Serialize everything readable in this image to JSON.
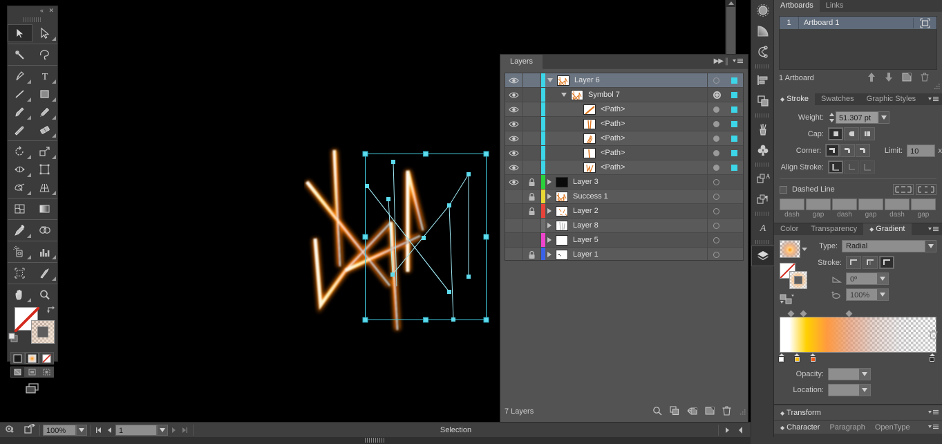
{
  "toolbar": {
    "collapse_label": "«",
    "close_label": "✕",
    "tools": [
      {
        "name": "selection-tool",
        "icon": "arrow-solid",
        "selected": true,
        "hasflyout": false
      },
      {
        "name": "direct-selection-tool",
        "icon": "arrow-outline",
        "selected": false,
        "hasflyout": true
      },
      {
        "name": "magic-wand-tool",
        "icon": "wand",
        "selected": false,
        "hasflyout": false
      },
      {
        "name": "lasso-tool",
        "icon": "lasso",
        "selected": false,
        "hasflyout": false
      },
      {
        "name": "pen-tool",
        "icon": "pen",
        "selected": false,
        "hasflyout": true
      },
      {
        "name": "type-tool",
        "icon": "type-T",
        "selected": false,
        "hasflyout": true
      },
      {
        "name": "line-segment-tool",
        "icon": "line",
        "selected": false,
        "hasflyout": true
      },
      {
        "name": "rectangle-tool",
        "icon": "rectangle",
        "selected": false,
        "hasflyout": true
      },
      {
        "name": "paintbrush-tool",
        "icon": "brush",
        "selected": false,
        "hasflyout": true
      },
      {
        "name": "pencil-tool",
        "icon": "pencil",
        "selected": false,
        "hasflyout": true
      },
      {
        "name": "blob-brush-tool",
        "icon": "blob-brush",
        "selected": false,
        "hasflyout": false
      },
      {
        "name": "eraser-tool",
        "icon": "eraser",
        "selected": false,
        "hasflyout": true
      },
      {
        "name": "rotate-tool",
        "icon": "rotate",
        "selected": false,
        "hasflyout": true
      },
      {
        "name": "scale-tool",
        "icon": "scale",
        "selected": false,
        "hasflyout": true
      },
      {
        "name": "width-tool",
        "icon": "width",
        "selected": false,
        "hasflyout": true
      },
      {
        "name": "free-transform-tool",
        "icon": "free-transform",
        "selected": false,
        "hasflyout": false
      },
      {
        "name": "shape-builder-tool",
        "icon": "shape-builder",
        "selected": false,
        "hasflyout": true
      },
      {
        "name": "perspective-grid-tool",
        "icon": "perspective-grid",
        "selected": false,
        "hasflyout": true
      },
      {
        "name": "mesh-tool",
        "icon": "mesh",
        "selected": false,
        "hasflyout": false
      },
      {
        "name": "gradient-tool",
        "icon": "gradient",
        "selected": false,
        "hasflyout": false
      },
      {
        "name": "eyedropper-tool",
        "icon": "eyedropper",
        "selected": false,
        "hasflyout": true
      },
      {
        "name": "blend-tool",
        "icon": "blend",
        "selected": false,
        "hasflyout": false
      },
      {
        "name": "symbol-sprayer-tool",
        "icon": "symbol-sprayer",
        "selected": false,
        "hasflyout": true
      },
      {
        "name": "column-graph-tool",
        "icon": "bar-graph",
        "selected": false,
        "hasflyout": true
      },
      {
        "name": "artboard-tool",
        "icon": "artboard",
        "selected": false,
        "hasflyout": false
      },
      {
        "name": "slice-tool",
        "icon": "slice-knife",
        "selected": false,
        "hasflyout": true
      },
      {
        "name": "hand-tool",
        "icon": "hand",
        "selected": false,
        "hasflyout": true
      },
      {
        "name": "zoom-tool",
        "icon": "magnifier",
        "selected": false,
        "hasflyout": false
      }
    ],
    "fill_stroke": {
      "fill_name": "fill-swatch-none",
      "stroke_name": "stroke-swatch-gradient",
      "swap_name": "swap-fill-stroke-icon",
      "default_name": "default-fill-stroke-icon",
      "modes": [
        {
          "name": "color-mode-button",
          "selected": false
        },
        {
          "name": "gradient-mode-button",
          "selected": true
        },
        {
          "name": "none-mode-button",
          "selected": false
        }
      ],
      "draw_modes": [
        {
          "name": "draw-normal-button",
          "selected": true
        },
        {
          "name": "draw-behind-button",
          "selected": false
        },
        {
          "name": "draw-inside-button",
          "selected": false
        }
      ],
      "screen_mode_name": "change-screen-mode-button"
    }
  },
  "canvas": {
    "artwork_name": "selected-artwork-glowing-strokes",
    "selection_name": "selection-bounding-box",
    "background_color": "#000000",
    "selection_color": "#42d2e8"
  },
  "layers_panel": {
    "tab_label": "Layers",
    "collapse_icon": "double-arrow-right-icon",
    "menu_icon": "panel-menu-icon",
    "footer_count": "7 Layers",
    "footer_buttons": [
      {
        "name": "locate-object-button",
        "icon": "magnifier-icon"
      },
      {
        "name": "make-clipping-mask-button",
        "icon": "clipping-mask-icon"
      },
      {
        "name": "create-new-sublayer-button",
        "icon": "new-sublayer-icon"
      },
      {
        "name": "create-new-layer-button",
        "icon": "new-layer-icon"
      },
      {
        "name": "delete-selection-button",
        "icon": "trash-icon"
      }
    ],
    "rows": [
      {
        "name": "Layer 6",
        "indent": 0,
        "visible": true,
        "locked": false,
        "color": "#3cd6e8",
        "expanded": true,
        "has_twirl": true,
        "selected": true,
        "target": "circle",
        "has_square": true,
        "thumb": "artwork-orange"
      },
      {
        "name": "Symbol 7",
        "indent": 1,
        "visible": true,
        "locked": false,
        "color": "#3cd6e8",
        "expanded": true,
        "has_twirl": true,
        "selected": false,
        "target": "double-circle",
        "has_square": true,
        "thumb": "artwork-orange"
      },
      {
        "name": "<Path>",
        "indent": 2,
        "visible": true,
        "locked": false,
        "color": "#3cd6e8",
        "expanded": false,
        "has_twirl": false,
        "selected": false,
        "target": "filled",
        "has_square": true,
        "thumb": "path-diag"
      },
      {
        "name": "<Path>",
        "indent": 2,
        "visible": true,
        "locked": false,
        "color": "#3cd6e8",
        "expanded": false,
        "has_twirl": false,
        "selected": false,
        "target": "filled",
        "has_square": true,
        "thumb": "path-vert"
      },
      {
        "name": "<Path>",
        "indent": 2,
        "visible": true,
        "locked": false,
        "color": "#3cd6e8",
        "expanded": false,
        "has_twirl": false,
        "selected": false,
        "target": "filled",
        "has_square": true,
        "thumb": "path-fan"
      },
      {
        "name": "<Path>",
        "indent": 2,
        "visible": true,
        "locked": false,
        "color": "#3cd6e8",
        "expanded": false,
        "has_twirl": false,
        "selected": false,
        "target": "filled",
        "has_square": true,
        "thumb": "path-vert2"
      },
      {
        "name": "<Path>",
        "indent": 2,
        "visible": true,
        "locked": false,
        "color": "#3cd6e8",
        "expanded": false,
        "has_twirl": false,
        "selected": false,
        "target": "filled",
        "has_square": true,
        "thumb": "path-zig"
      },
      {
        "name": "Layer 3",
        "indent": 0,
        "visible": true,
        "locked": true,
        "color": "#2ad13a",
        "expanded": false,
        "has_twirl": true,
        "selected": false,
        "target": "circle",
        "has_square": false,
        "thumb": "black"
      },
      {
        "name": "Success 1",
        "indent": 0,
        "visible": false,
        "locked": true,
        "color": "#e8d836",
        "expanded": false,
        "has_twirl": true,
        "selected": false,
        "target": "circle",
        "has_square": false,
        "thumb": "artwork-orange"
      },
      {
        "name": "Layer 2",
        "indent": 0,
        "visible": false,
        "locked": true,
        "color": "#e8433a",
        "expanded": false,
        "has_twirl": true,
        "selected": false,
        "target": "circle",
        "has_square": false,
        "thumb": "sparse-orange"
      },
      {
        "name": "Layer 8",
        "indent": 0,
        "visible": false,
        "locked": false,
        "color": "#6e6e6e",
        "expanded": false,
        "has_twirl": true,
        "selected": false,
        "target": "circle",
        "has_square": false,
        "thumb": "grey-lines"
      },
      {
        "name": "Layer 5",
        "indent": 0,
        "visible": false,
        "locked": false,
        "color": "#ef44cd",
        "expanded": false,
        "has_twirl": true,
        "selected": false,
        "target": "circle",
        "has_square": false,
        "thumb": "white"
      },
      {
        "name": "Layer 1",
        "indent": 0,
        "visible": false,
        "locked": true,
        "color": "#3a62e8",
        "expanded": false,
        "has_twirl": true,
        "selected": false,
        "target": "circle",
        "has_square": false,
        "thumb": "tiny-mark"
      }
    ]
  },
  "dock": {
    "items": [
      {
        "name": "brushes-icon",
        "glyph": "brush-circle",
        "active": false
      },
      {
        "name": "symbols-icon",
        "glyph": "quarter-gradient",
        "active": false
      },
      {
        "name": "graphic-styles-icon",
        "glyph": "node-link",
        "active": false
      },
      {
        "name": "align-icon",
        "glyph": "align-bars",
        "active": false
      },
      {
        "name": "pathfinder-icon",
        "glyph": "two-squares",
        "active": false
      },
      {
        "name": "brush-libraries-icon",
        "glyph": "brush-cup",
        "active": false
      },
      {
        "name": "symbol-libraries-icon",
        "glyph": "club",
        "active": false
      },
      {
        "name": "appearance-icon",
        "glyph": "square-A",
        "active": false
      },
      {
        "name": "paragraph-styles-icon",
        "glyph": "square-pilcrow",
        "active": false
      },
      {
        "name": "character-styles-icon",
        "glyph": "script-A",
        "active": false
      },
      {
        "name": "layers-icon",
        "glyph": "layers-stack",
        "active": true
      }
    ]
  },
  "artboards_panel": {
    "tabs": [
      {
        "label": "Artboards",
        "active": true
      },
      {
        "label": "Links",
        "active": false
      }
    ],
    "row_number": "1",
    "row_name": "Artboard 1",
    "row_icon": "artboard-options-icon",
    "footer_label": "1 Artboard",
    "footer_buttons": [
      {
        "name": "move-up-button",
        "icon": "up-arrow-icon"
      },
      {
        "name": "move-down-button",
        "icon": "down-arrow-icon"
      },
      {
        "name": "new-artboard-button",
        "icon": "new-artboard-icon"
      },
      {
        "name": "delete-artboard-button",
        "icon": "trash-icon"
      }
    ]
  },
  "stroke_panel": {
    "tabs": [
      {
        "label": "Stroke",
        "active": true
      },
      {
        "label": "Swatches",
        "active": false
      },
      {
        "label": "Graphic Styles",
        "active": false
      }
    ],
    "weight_label": "Weight:",
    "weight_value": "51.307 pt",
    "cap_label": "Cap:",
    "caps": [
      {
        "name": "butt-cap-button",
        "selected": true
      },
      {
        "name": "round-cap-button",
        "selected": false
      },
      {
        "name": "projecting-cap-button",
        "selected": false
      }
    ],
    "corner_label": "Corner:",
    "corners": [
      {
        "name": "miter-join-button",
        "selected": true
      },
      {
        "name": "round-join-button",
        "selected": false
      },
      {
        "name": "bevel-join-button",
        "selected": false
      }
    ],
    "limit_label": "Limit:",
    "limit_value": "10",
    "limit_unit": "x",
    "align_label": "Align Stroke:",
    "aligns": [
      {
        "name": "align-stroke-center-button",
        "selected": true
      },
      {
        "name": "align-stroke-inside-button",
        "selected": false
      },
      {
        "name": "align-stroke-outside-button",
        "selected": false
      }
    ],
    "dashed_label": "Dashed Line",
    "dashed_checked": false,
    "dash_buttons": [
      {
        "name": "dashes-preserve-exact-button"
      },
      {
        "name": "dashes-align-corners-button"
      }
    ],
    "dash_fields": [
      {
        "label": "dash",
        "value": ""
      },
      {
        "label": "gap",
        "value": ""
      },
      {
        "label": "dash",
        "value": ""
      },
      {
        "label": "gap",
        "value": ""
      },
      {
        "label": "dash",
        "value": ""
      },
      {
        "label": "gap",
        "value": ""
      }
    ]
  },
  "gradient_panel": {
    "tabs": [
      {
        "label": "Color",
        "active": false
      },
      {
        "label": "Transparency",
        "active": false
      },
      {
        "label": "Gradient",
        "active": true
      }
    ],
    "type_label": "Type:",
    "type_value": "Radial",
    "stroke_label": "Stroke:",
    "stroke_options": [
      {
        "name": "gradient-within-stroke-button",
        "selected": false
      },
      {
        "name": "gradient-along-stroke-button",
        "selected": false
      },
      {
        "name": "gradient-across-stroke-button",
        "selected": true
      }
    ],
    "angle_label": "angle-icon",
    "angle_value": "0º",
    "aspect_label": "aspect-ratio-icon",
    "aspect_value": "100%",
    "gradient_swatch_name": "gradient-fill-swatch",
    "fill_swatch_name": "gradient-fill-none-swatch",
    "stroke_swatch_name": "gradient-stroke-swatch",
    "reverse_name": "reverse-gradient-button",
    "delete_stop_name": "delete-gradient-stop-button",
    "stops": [
      {
        "pos": 1,
        "color": "#ffffff",
        "name": "gradient-stop-white"
      },
      {
        "pos": 11,
        "color": "#ffbf00",
        "name": "gradient-stop-amber"
      },
      {
        "pos": 21,
        "color": "#f05a18",
        "name": "gradient-stop-orange"
      },
      {
        "pos": 97,
        "color": "#2b2b2b",
        "name": "gradient-stop-transparent"
      }
    ],
    "midpoints": [
      7,
      15,
      44
    ],
    "opacity_label": "Opacity:",
    "opacity_value": "",
    "location_label": "Location:",
    "location_value": ""
  },
  "bottom_panels": {
    "transform": {
      "label": "Transform"
    },
    "character_tabs": [
      {
        "label": "Character",
        "active": true
      },
      {
        "label": "Paragraph",
        "active": false
      },
      {
        "label": "OpenType",
        "active": false
      }
    ]
  },
  "status_bar": {
    "preferences_icon": "gear-undo-icon",
    "export_icon": "export-icon",
    "zoom_value": "100%",
    "page_value": "1",
    "status_text": "Selection",
    "nav_first_icon": "first-page-icon",
    "nav_prev_icon": "prev-page-icon",
    "nav_next_icon": "next-page-icon",
    "nav_last_icon": "last-page-icon",
    "expand_icon": "right-triangle-icon",
    "collapse_icon": "left-triangle-icon"
  }
}
